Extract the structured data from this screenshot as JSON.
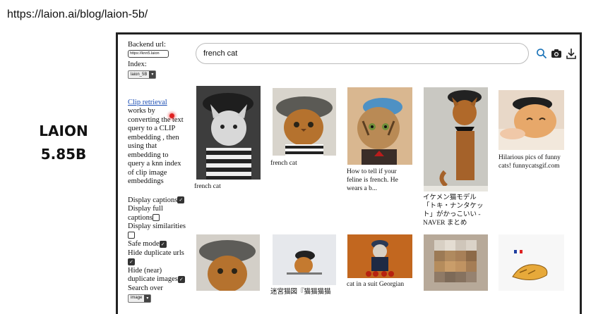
{
  "page_url": "https://laion.ai/blog/laion-5b/",
  "brand": {
    "line1": "LAION",
    "line2": "5.85B"
  },
  "left_panel": {
    "backend_label": "Backend url:",
    "backend_value": "https://knn5.laion",
    "index_label": "Index:",
    "index_value": "laion_5B",
    "clip_link": "Clip retrieval",
    "description": " works by converting the text query to a CLIP embedding , then using that embedding to query a knn index of clip image embeddings",
    "options": [
      {
        "label": "Display captions",
        "checked": true
      },
      {
        "label": "Display full captions",
        "checked": false
      },
      {
        "label": "Display similarities",
        "checked": false
      },
      {
        "label": "Safe mode",
        "checked": true
      },
      {
        "label": "Hide duplicate urls",
        "checked": true
      },
      {
        "label": "Hide (near) duplicate images",
        "checked": true
      }
    ],
    "search_over_label": "Search over",
    "search_over_value": "image"
  },
  "search": {
    "query": "french cat"
  },
  "icons": {
    "search": "search-icon",
    "camera": "camera-icon",
    "download": "download-icon"
  },
  "results": [
    {
      "caption": "french cat"
    },
    {
      "caption": "french cat"
    },
    {
      "caption": "How to tell if your feline is french. He wears a b..."
    },
    {
      "caption": "イケメン猫モデル「トキ・ナンタケット」がかっこいい - NAVER まとめ"
    },
    {
      "caption": "Hilarious pics of funny cats! funnycatsgif.com"
    },
    {
      "caption": ""
    },
    {
      "caption": "迷宮猫図『猫猫猫猫"
    },
    {
      "caption": "cat in a suit Georgian"
    },
    {
      "caption": ""
    },
    {
      "caption": ""
    }
  ]
}
